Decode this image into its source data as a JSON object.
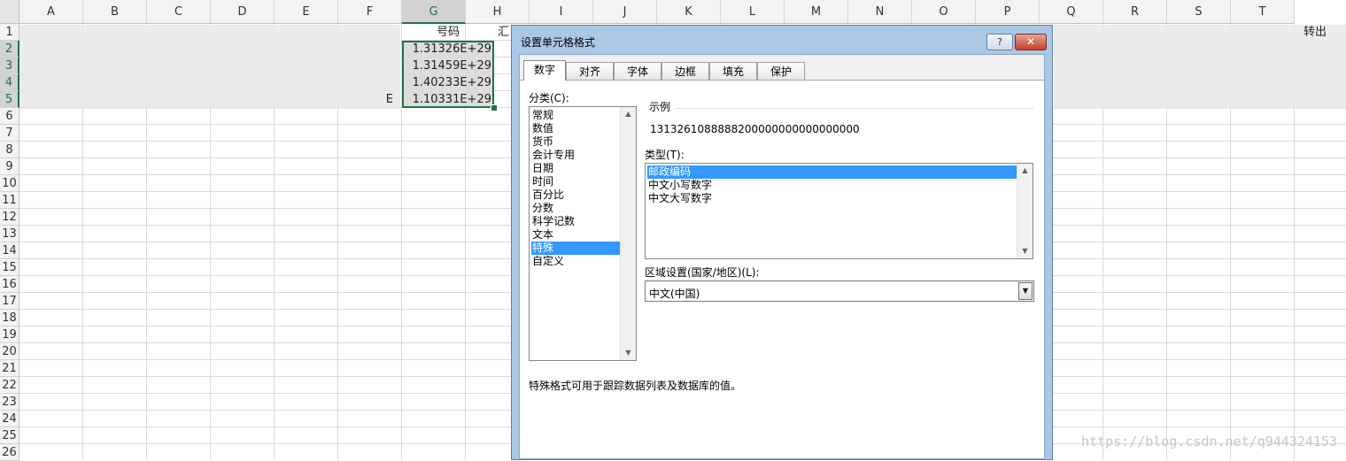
{
  "spreadsheet": {
    "columns": [
      "A",
      "B",
      "C",
      "D",
      "E",
      "F",
      "G",
      "H",
      "I",
      "J",
      "K",
      "L",
      "M",
      "N",
      "O",
      "P",
      "Q",
      "R",
      "S",
      "T"
    ],
    "rows": [
      "1",
      "2",
      "3",
      "4",
      "5",
      "6",
      "7",
      "8",
      "9",
      "10",
      "11",
      "12",
      "13",
      "14",
      "15",
      "16",
      "17",
      "18",
      "19",
      "20",
      "21",
      "22",
      "23",
      "24",
      "25",
      "26"
    ],
    "selected_column": "G",
    "g_header": "号码",
    "h1_partial": "汇",
    "f5_partial": "E",
    "g_values": [
      "1.31326E+29",
      "1.31459E+29",
      "1.40233E+29",
      "1.10331E+29"
    ],
    "right_partial": "转出"
  },
  "watermark": "https://blog.csdn.net/q944324153",
  "dialog": {
    "title": "设置单元格格式",
    "help": "?",
    "close": "✕",
    "tabs": [
      "数字",
      "对齐",
      "字体",
      "边框",
      "填充",
      "保护"
    ],
    "active_tab": "数字",
    "category_label": "分类(C):",
    "categories": [
      "常规",
      "数值",
      "货币",
      "会计专用",
      "日期",
      "时间",
      "百分比",
      "分数",
      "科学记数",
      "文本",
      "特殊",
      "自定义"
    ],
    "selected_category": "特殊",
    "sample_label": "示例",
    "sample_value": "1313261088888200000000000000000",
    "type_label": "类型(T):",
    "types": [
      "邮政编码",
      "中文小写数字",
      "中文大写数字"
    ],
    "selected_type": "邮政编码",
    "locale_label": "区域设置(国家/地区)(L):",
    "locale_value": "中文(中国)",
    "description": "特殊格式可用于跟踪数据列表及数据库的值。"
  }
}
